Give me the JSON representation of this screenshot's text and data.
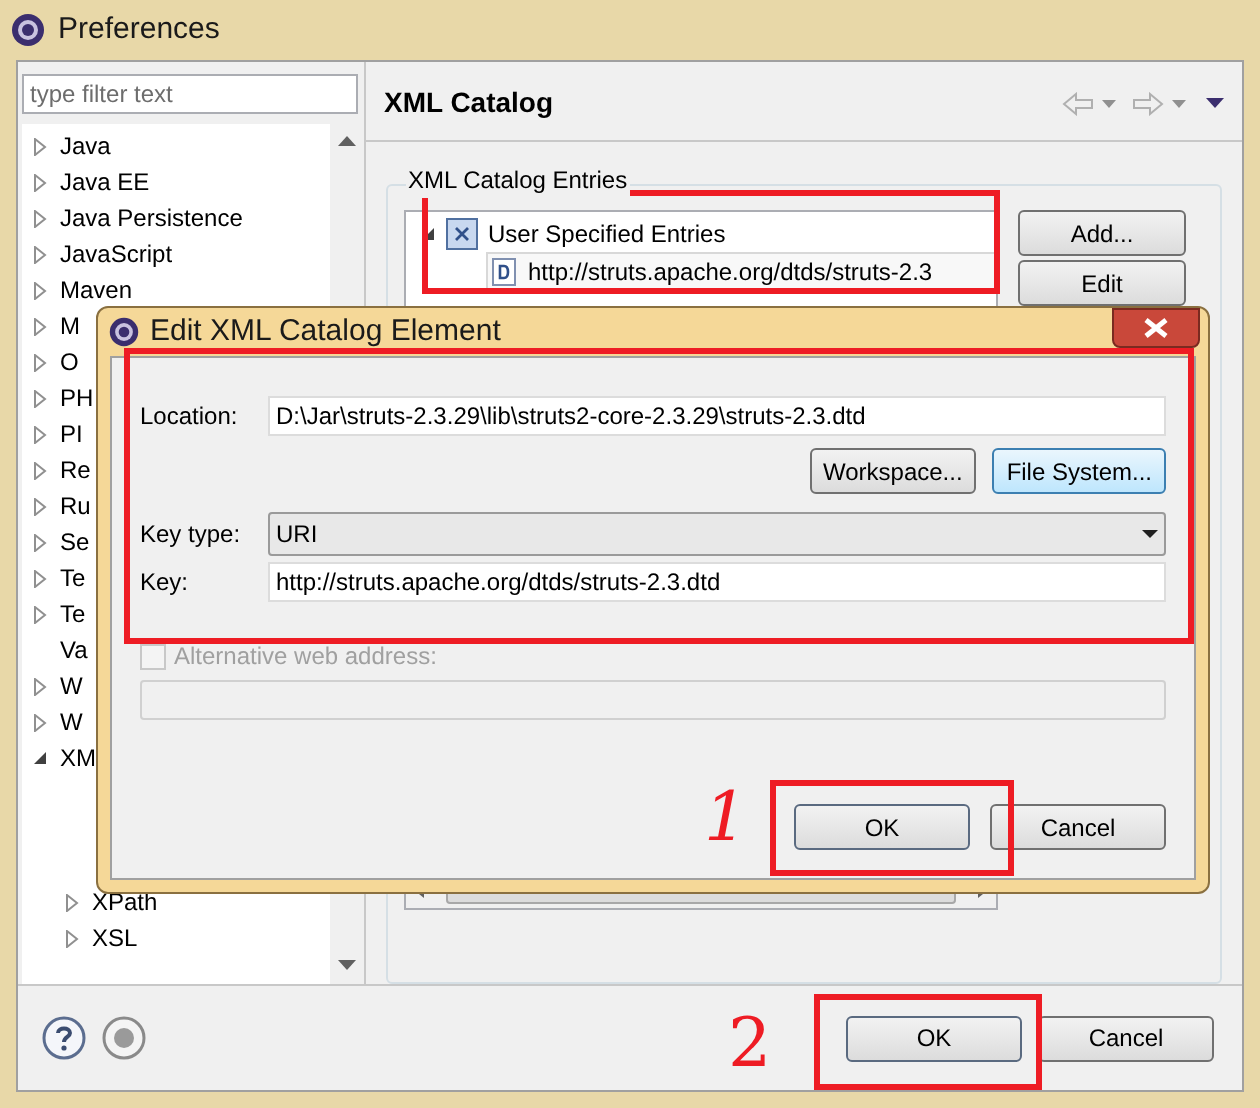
{
  "window": {
    "title": "Preferences"
  },
  "sidebar": {
    "filter_placeholder": "type filter text",
    "items": [
      {
        "label": "Java",
        "expandable": true,
        "expanded": false
      },
      {
        "label": "Java EE",
        "expandable": true,
        "expanded": false
      },
      {
        "label": "Java Persistence",
        "expandable": true,
        "expanded": false
      },
      {
        "label": "JavaScript",
        "expandable": true,
        "expanded": false
      },
      {
        "label": "Maven",
        "expandable": true,
        "expanded": false
      },
      {
        "label": "M",
        "expandable": true,
        "expanded": false
      },
      {
        "label": "O",
        "expandable": true,
        "expanded": false
      },
      {
        "label": "PH",
        "expandable": true,
        "expanded": false
      },
      {
        "label": "PI",
        "expandable": true,
        "expanded": false
      },
      {
        "label": "Re",
        "expandable": true,
        "expanded": false
      },
      {
        "label": "Ru",
        "expandable": true,
        "expanded": false
      },
      {
        "label": "Se",
        "expandable": true,
        "expanded": false
      },
      {
        "label": "Te",
        "expandable": true,
        "expanded": false
      },
      {
        "label": "Te",
        "expandable": true,
        "expanded": false
      },
      {
        "label": "Va",
        "expandable": false
      },
      {
        "label": "W",
        "expandable": true,
        "expanded": false
      },
      {
        "label": "W",
        "expandable": true,
        "expanded": false
      },
      {
        "label": "XM",
        "expandable": true,
        "expanded": true,
        "children": [
          {
            "label": "XPath",
            "expandable": true,
            "expanded": false
          },
          {
            "label": "XSL",
            "expandable": true,
            "expanded": false
          }
        ]
      }
    ]
  },
  "page": {
    "title": "XML Catalog",
    "group_label": "XML Catalog Entries",
    "entries": [
      {
        "label": "User Specified Entries",
        "expanded": true,
        "children": [
          {
            "label": "http://struts.apache.org/dtds/struts-2.3"
          }
        ]
      }
    ],
    "buttons": [
      "Add...",
      "Edit"
    ]
  },
  "footer": {
    "buttons": [
      {
        "label": "OK",
        "default": true
      },
      {
        "label": "Cancel",
        "default": false
      }
    ]
  },
  "dialog": {
    "title": "Edit XML Catalog Element",
    "location_label": "Location:",
    "location": "D:\\Jar\\struts-2.3.29\\lib\\struts2-core-2.3.29\\struts-2.3.dtd",
    "browse_buttons": [
      {
        "label": "Workspace...",
        "focused": false
      },
      {
        "label": "File System...",
        "focused": true
      }
    ],
    "key_type_label": "Key type:",
    "key_type": "URI",
    "key_label": "Key:",
    "key": "http://struts.apache.org/dtds/struts-2.3.dtd",
    "alternative": {
      "label": "Alternative web address:",
      "checked": false,
      "disabled": true
    },
    "buttons": [
      {
        "label": "OK",
        "default": true
      },
      {
        "label": "Cancel",
        "default": false
      }
    ]
  },
  "annotations": [
    {
      "label": "1"
    },
    {
      "label": "2"
    }
  ]
}
